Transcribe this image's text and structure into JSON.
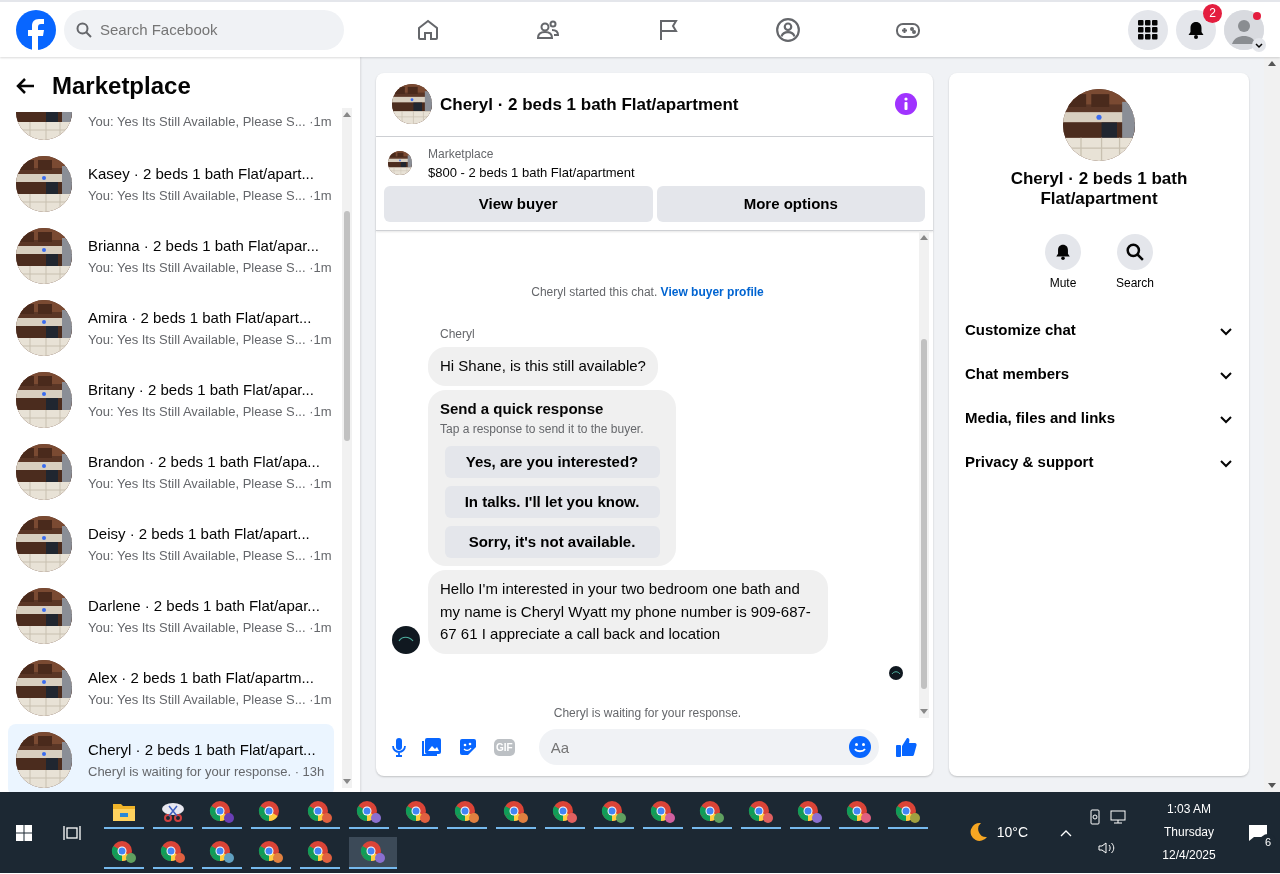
{
  "topbar": {
    "search": {
      "placeholder": "Search Facebook"
    },
    "nav_tabs": [
      {
        "kind": "home",
        "selected": false
      },
      {
        "kind": "friends",
        "selected": false
      },
      {
        "kind": "pages",
        "selected": false
      },
      {
        "kind": "groups",
        "selected": false
      },
      {
        "kind": "gaming",
        "selected": false
      }
    ],
    "notifications_badge": "2"
  },
  "sidebar": {
    "title": "Marketplace",
    "conversations": [
      {
        "kind": "partial",
        "preview": "You: Yes Its Still Available, Please S...",
        "time": "·1m",
        "selected": false
      },
      {
        "name": "Kasey · 2 beds 1 bath Flat/apart...",
        "preview": "You: Yes Its Still Available, Please S...",
        "time": "·1m",
        "selected": false
      },
      {
        "name": "Brianna · 2 beds 1 bath Flat/apar...",
        "preview": "You: Yes Its Still Available, Please S...",
        "time": "·1m",
        "selected": false
      },
      {
        "name": "Amira · 2 beds 1 bath Flat/apart...",
        "preview": "You: Yes Its Still Available, Please S...",
        "time": "·1m",
        "selected": false
      },
      {
        "name": "Britany · 2 beds 1 bath Flat/apar...",
        "preview": "You: Yes Its Still Available, Please S...",
        "time": "·1m",
        "selected": false
      },
      {
        "name": "Brandon · 2 beds 1 bath Flat/apa...",
        "preview": "You: Yes Its Still Available, Please S...",
        "time": "·1m",
        "selected": false
      },
      {
        "name": "Deisy · 2 beds 1 bath Flat/apart...",
        "preview": "You: Yes Its Still Available, Please S...",
        "time": "·1m",
        "selected": false
      },
      {
        "name": "Darlene · 2 beds 1 bath Flat/apar...",
        "preview": "You: Yes Its Still Available, Please S...",
        "time": "·1m",
        "selected": false
      },
      {
        "name": "Alex · 2 beds 1 bath Flat/apartm...",
        "preview": "You: Yes Its Still Available, Please S...",
        "time": "·1m",
        "selected": false
      },
      {
        "name": "Cheryl · 2 beds 1 bath Flat/apart...",
        "preview": "Cheryl is waiting for your response.",
        "time": "· 13h",
        "selected": true
      }
    ]
  },
  "chat": {
    "title": "Cheryl · 2 beds 1 bath Flat/apartment",
    "listing": {
      "label": "Marketplace",
      "text": "$800 - 2 beds 1 bath Flat/apartment"
    },
    "buttons": [
      "View buyer",
      "More options"
    ],
    "messages": [
      {
        "kind": "system",
        "text": "Cheryl started this chat.",
        "link": "View buyer profile"
      },
      {
        "kind": "sender",
        "text": "Cheryl"
      },
      {
        "kind": "bubble",
        "text": "Hi Shane, is this still available?",
        "avatar": false
      },
      {
        "kind": "quick",
        "title": "Send a quick response",
        "subtitle": "Tap a response to send it to the buyer.",
        "options": [
          "Yes, are you interested?",
          "In talks. I'll let you know.",
          "Sorry, it's not available."
        ]
      },
      {
        "kind": "bubble",
        "text": "Hello I'm interested in your two bedroom one bath and my name is Cheryl Wyatt my phone number is 909-687-67 61 I appreciate a call back and location",
        "avatar": true
      },
      {
        "kind": "seen"
      },
      {
        "kind": "system",
        "text": "Cheryl is waiting for your response."
      }
    ],
    "composer": {
      "gif": "GIF",
      "placeholder": "Aa"
    }
  },
  "details": {
    "title": "Cheryl · 2 beds 1 bath Flat/apartment",
    "actions": [
      {
        "kind": "bell",
        "label": "Mute"
      },
      {
        "kind": "search",
        "label": "Search"
      }
    ],
    "sections": [
      {
        "label": "Customize chat",
        "expanded": false
      },
      {
        "label": "Chat members",
        "expanded": false
      },
      {
        "label": "Media, files and links",
        "expanded": false
      },
      {
        "label": "Privacy & support",
        "expanded": false
      }
    ]
  },
  "taskbar": {
    "apps": [
      {
        "kind": "folder",
        "selected": false
      },
      {
        "kind": "snip",
        "selected": false
      },
      {
        "kind": "chrome",
        "color": "#6a3fb5",
        "selected": false
      },
      {
        "kind": "chrome",
        "selected": false
      },
      {
        "kind": "chrome",
        "color": "#e06040",
        "selected": false
      },
      {
        "kind": "chrome",
        "color": "#8a6fd0",
        "selected": false
      },
      {
        "kind": "chrome",
        "color": "#e06040",
        "selected": false
      },
      {
        "kind": "chrome",
        "color": "#e08040",
        "selected": false
      },
      {
        "kind": "chrome",
        "color": "#e08040",
        "selected": false
      },
      {
        "kind": "chrome",
        "color": "#e06060",
        "selected": false
      },
      {
        "kind": "chrome",
        "color": "#60a060",
        "selected": false
      },
      {
        "kind": "chrome",
        "color": "#d060a0",
        "selected": false
      },
      {
        "kind": "chrome",
        "color": "#60a060",
        "selected": false
      },
      {
        "kind": "chrome",
        "color": "#e06060",
        "selected": false
      },
      {
        "kind": "chrome",
        "color": "#8a6fd0",
        "selected": false
      },
      {
        "kind": "chrome",
        "color": "#e06080",
        "selected": false
      },
      {
        "kind": "chrome",
        "color": "#a0a040",
        "selected": false
      },
      {
        "kind": "chrome",
        "color": "#60a060",
        "selected": false
      },
      {
        "kind": "chrome",
        "color": "#e06040",
        "selected": false
      },
      {
        "kind": "chrome",
        "color": "#60a0c0",
        "selected": false
      },
      {
        "kind": "chrome",
        "color": "#e08040",
        "selected": false
      },
      {
        "kind": "chrome",
        "color": "#e06040",
        "selected": false
      },
      {
        "kind": "chrome",
        "color": "#8a6fd0",
        "selected": true
      }
    ],
    "weather": "10°C",
    "time": "1:03 AM",
    "day": "Thursday",
    "date": "12/4/2025",
    "notification_count": "6"
  }
}
